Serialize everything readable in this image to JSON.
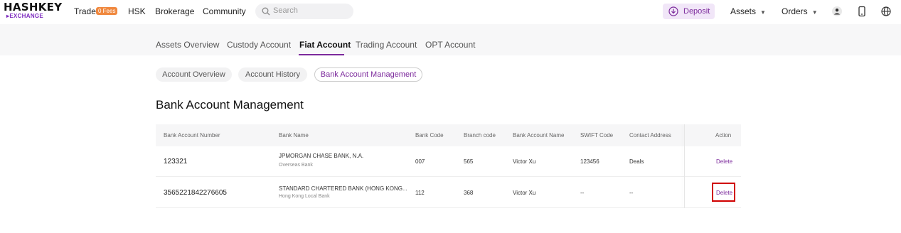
{
  "brand": {
    "line1": "HASHKEY",
    "line2": "EXCHANGE"
  },
  "nav": {
    "trade": "Trade",
    "fees_badge": "0 Fees",
    "hsk": "HSK",
    "brokerage": "Brokerage",
    "community": "Community",
    "search_placeholder": "Search",
    "deposit": "Deposit",
    "assets": "Assets",
    "orders": "Orders"
  },
  "subtabs": [
    "Assets Overview",
    "Custody Account",
    "Fiat Account",
    "Trading Account",
    "OPT Account"
  ],
  "pills": [
    "Account Overview",
    "Account History",
    "Bank Account Management"
  ],
  "page_title": "Bank Account Management",
  "table": {
    "headers": [
      "Bank Account Number",
      "Bank Name",
      "Bank Code",
      "Branch code",
      "Bank Account Name",
      "SWIFT Code",
      "Contact Address",
      "Action"
    ],
    "rows": [
      {
        "account_number": "123321",
        "bank_name": "JPMORGAN CHASE BANK, N.A.",
        "bank_type": "Overseas Bank",
        "bank_code": "007",
        "branch_code": "565",
        "account_name": "Victor Xu",
        "swift": "123456",
        "address": "Deals",
        "action": "Delete"
      },
      {
        "account_number": "3565221842276605",
        "bank_name": "STANDARD CHARTERED BANK (HONG KONG...",
        "bank_type": "Hong Kong Local Bank",
        "bank_code": "112",
        "branch_code": "368",
        "account_name": "Victor Xu",
        "swift": "--",
        "address": "--",
        "action": "Delete"
      }
    ]
  },
  "colors": {
    "accent": "#7c2a9c",
    "badge": "#f0883e",
    "highlight": "#d00000"
  }
}
